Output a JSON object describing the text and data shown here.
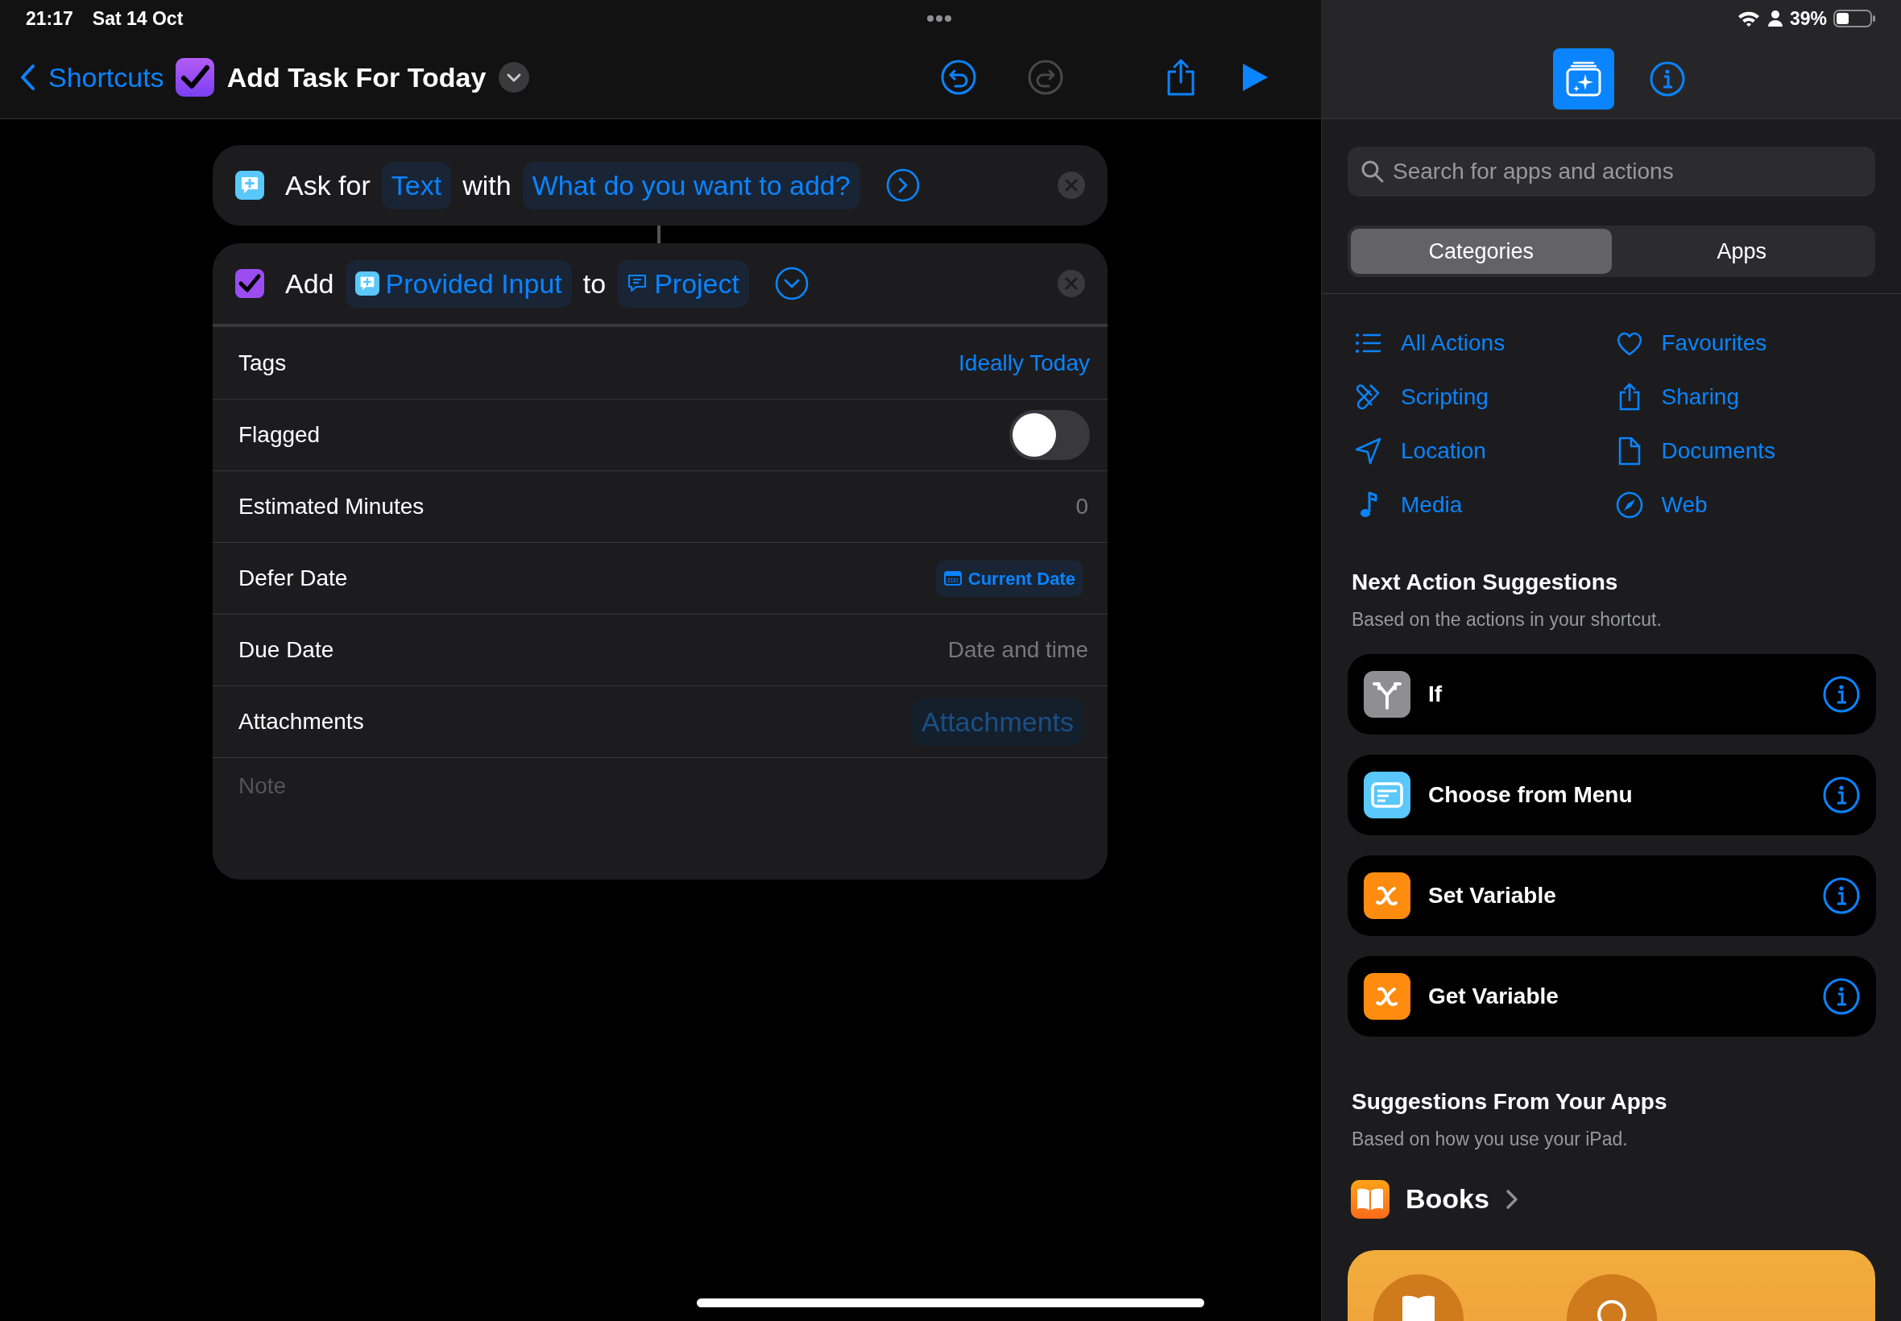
{
  "status_bar": {
    "time": "21:17",
    "date": "Sat 14 Oct",
    "battery": "39%"
  },
  "toolbar": {
    "back": "Shortcuts",
    "title": "Add Task For Today"
  },
  "actions": [
    {
      "kind": "ask",
      "expanded": false,
      "parts": [
        {
          "kind": "word",
          "text": "Ask for"
        },
        {
          "kind": "token",
          "text": "Text"
        },
        {
          "kind": "word",
          "text": "with"
        },
        {
          "kind": "token",
          "text": "What do you want to add?"
        }
      ]
    },
    {
      "kind": "add",
      "expanded": true,
      "parts": [
        {
          "kind": "word",
          "text": "Add"
        },
        {
          "kind": "variable",
          "text": "Provided Input"
        },
        {
          "kind": "word",
          "text": "to"
        },
        {
          "kind": "list",
          "text": "Project"
        }
      ],
      "parameters": [
        {
          "kind": "value",
          "label": "Tags",
          "value": "Ideally Today"
        },
        {
          "kind": "toggle",
          "label": "Flagged",
          "on": false
        },
        {
          "kind": "field",
          "label": "Estimated Minutes",
          "placeholder": "0"
        },
        {
          "kind": "date-variable",
          "label": "Defer Date",
          "value": "Current Date"
        },
        {
          "kind": "field",
          "label": "Due Date",
          "placeholder": "Date and time"
        },
        {
          "kind": "faded-token",
          "label": "Attachments",
          "value": "Attachments"
        }
      ],
      "note": {
        "placeholder": "Note"
      }
    }
  ],
  "sidebar": {
    "tabs": [
      {
        "kind": "library",
        "selected": true
      },
      {
        "kind": "info",
        "selected": false
      }
    ],
    "search": {
      "placeholder": "Search for apps and actions"
    },
    "segments": [
      {
        "label": "Categories",
        "selected": true
      },
      {
        "label": "Apps",
        "selected": false
      }
    ],
    "categories": [
      {
        "kind": "all",
        "label": "All Actions"
      },
      {
        "kind": "favourites",
        "label": "Favourites"
      },
      {
        "kind": "scripting",
        "label": "Scripting"
      },
      {
        "kind": "sharing",
        "label": "Sharing"
      },
      {
        "kind": "location",
        "label": "Location"
      },
      {
        "kind": "documents",
        "label": "Documents"
      },
      {
        "kind": "media",
        "label": "Media"
      },
      {
        "kind": "web",
        "label": "Web"
      }
    ],
    "next_suggestions": {
      "title": "Next Action Suggestions",
      "subtitle": "Based on the actions in your shortcut.",
      "items": [
        {
          "kind": "if",
          "label": "If"
        },
        {
          "kind": "menu",
          "label": "Choose from Menu"
        },
        {
          "kind": "variable",
          "label": "Set Variable"
        },
        {
          "kind": "variable",
          "label": "Get Variable"
        }
      ]
    },
    "app_suggestions": {
      "title": "Suggestions From Your Apps",
      "subtitle": "Based on how you use your iPad.",
      "apps": [
        {
          "kind": "books",
          "name": "Books"
        }
      ]
    }
  }
}
